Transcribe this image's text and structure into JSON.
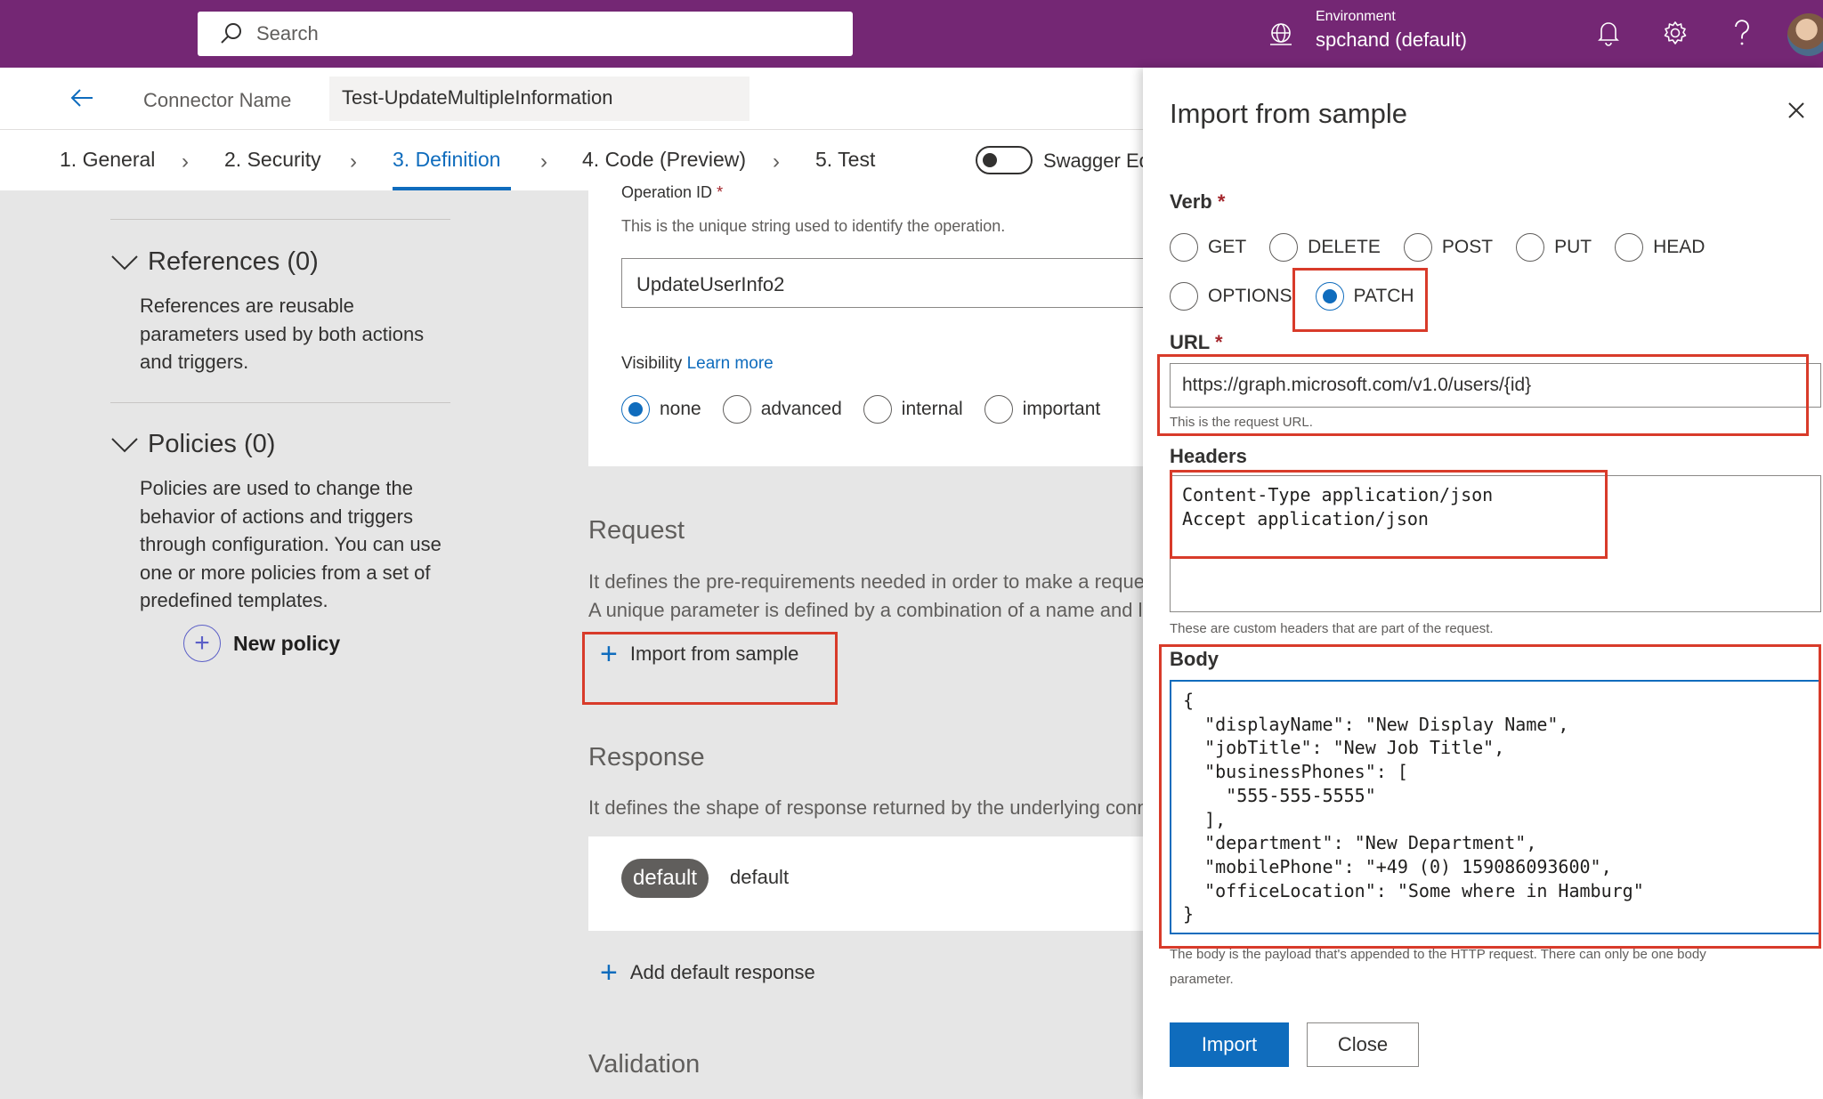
{
  "topbar": {
    "search_placeholder": "Search",
    "environment_label": "Environment",
    "environment_value": "spchand (default)",
    "icons": [
      "search-icon",
      "environment-icon",
      "bell-icon",
      "gear-icon",
      "help-icon",
      "avatar"
    ],
    "background_color": "#742774"
  },
  "header": {
    "connector_name_label": "Connector Name",
    "connector_name_value": "Test-UpdateMultipleInformation"
  },
  "tabs": {
    "items": [
      "1. General",
      "2. Security",
      "3. Definition",
      "4. Code (Preview)",
      "5. Test"
    ],
    "active": "3. Definition",
    "swagger_label": "Swagger Editor"
  },
  "sidebar": {
    "references_title": "References (0)",
    "references_desc": "References are reusable parameters used by both actions and triggers.",
    "policies_title": "Policies (0)",
    "policies_desc": "Policies are used to change the behavior of actions and triggers through configuration. You can use one or more policies from a set of predefined templates.",
    "new_policy_label": "New policy"
  },
  "main": {
    "operation_id_label": "Operation ID",
    "operation_id_required": "*",
    "operation_id_hint": "This is the unique string used to identify the operation.",
    "operation_id_value": "UpdateUserInfo2",
    "visibility_label": "Visibility",
    "visibility_link": "Learn more",
    "visibility_options": [
      "none",
      "advanced",
      "internal",
      "important"
    ],
    "visibility_selected": "none",
    "request_title": "Request",
    "request_desc_1": "It defines the pre-requirements needed in order to make a request.",
    "request_desc_2": "A unique parameter is defined by a combination of a name and location.",
    "import_from_sample": "Import from sample",
    "response_title": "Response",
    "response_desc": "It defines the shape of response returned by the underlying connector.",
    "response_pill": "default",
    "response_pill_text": "default",
    "add_default_response": "Add default response",
    "validation_title": "Validation"
  },
  "panel": {
    "title": "Import from sample",
    "verb_label": "Verb",
    "required": "*",
    "verbs_row1": [
      "GET",
      "DELETE",
      "POST",
      "PUT",
      "HEAD"
    ],
    "verbs_row2": [
      "OPTIONS",
      "PATCH"
    ],
    "verb_selected": "PATCH",
    "url_label": "URL",
    "url_value": "https://graph.microsoft.com/v1.0/users/{id}",
    "url_hint": "This is the request URL.",
    "headers_label": "Headers",
    "headers_value": "Content-Type application/json\nAccept application/json",
    "headers_hint": "These are custom headers that are part of the request.",
    "body_label": "Body",
    "body_value": "{\n  \"displayName\": \"New Display Name\",\n  \"jobTitle\": \"New Job Title\",\n  \"businessPhones\": [\n    \"555-555-5555\"\n  ],\n  \"department\": \"New Department\",\n  \"mobilePhone\": \"+49 (0) 159086093600\",\n  \"officeLocation\": \"Some where in Hamburg\"\n}",
    "body_hint_1": "The body is the payload that's appended to the HTTP request. There can only be one body",
    "body_hint_2": "parameter.",
    "import_button": "Import",
    "close_button": "Close"
  },
  "colors": {
    "accent": "#0f6cbd",
    "highlight": "#d83b2a"
  }
}
